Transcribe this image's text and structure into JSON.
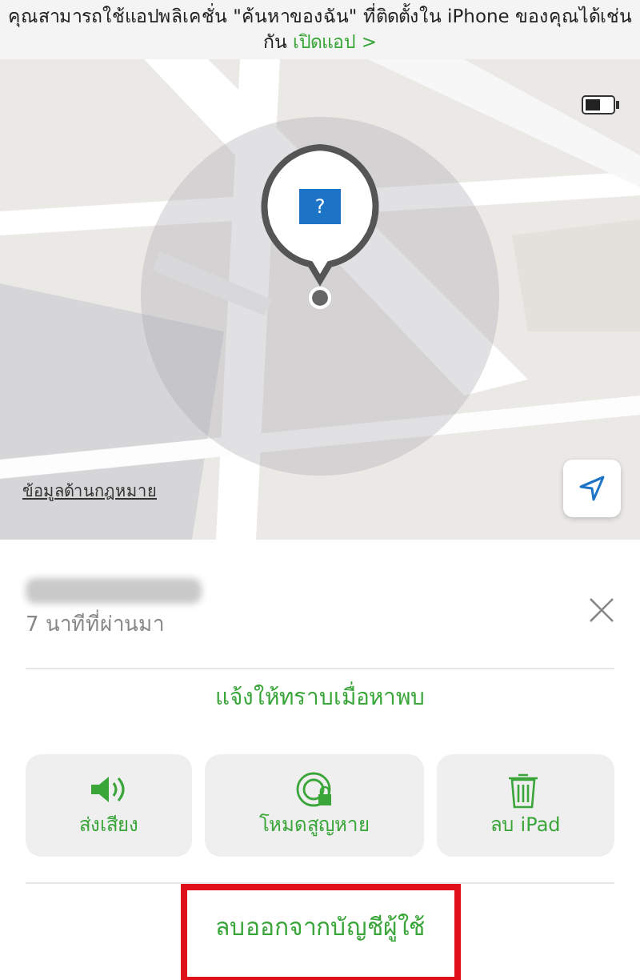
{
  "banner": {
    "text": "คุณสามารถใช้แอปพลิเคชั่น \"ค้นหาของฉัน\" ที่ติดตั้งใน iPhone ของคุณได้เช่นกัน",
    "link": "เปิดแอป >"
  },
  "map": {
    "kind": "picture",
    "pin_label": "?",
    "legal_link": "ข้อมูลด้านกฎหมาย"
  },
  "device": {
    "name_blurred": true,
    "time": "7 นาทีที่ผ่านมา"
  },
  "notify_link": "แจ้งให้ทราบเมื่อหาพบ",
  "actions": [
    {
      "kind": "sound",
      "label": "ส่งเสียง"
    },
    {
      "kind": "lost",
      "label": "โหมดสูญหาย"
    },
    {
      "kind": "erase",
      "label": "ลบ iPad"
    }
  ],
  "remove": {
    "label": "ลบออกจากบัญชีผู้ใช้",
    "highlighted": true
  }
}
